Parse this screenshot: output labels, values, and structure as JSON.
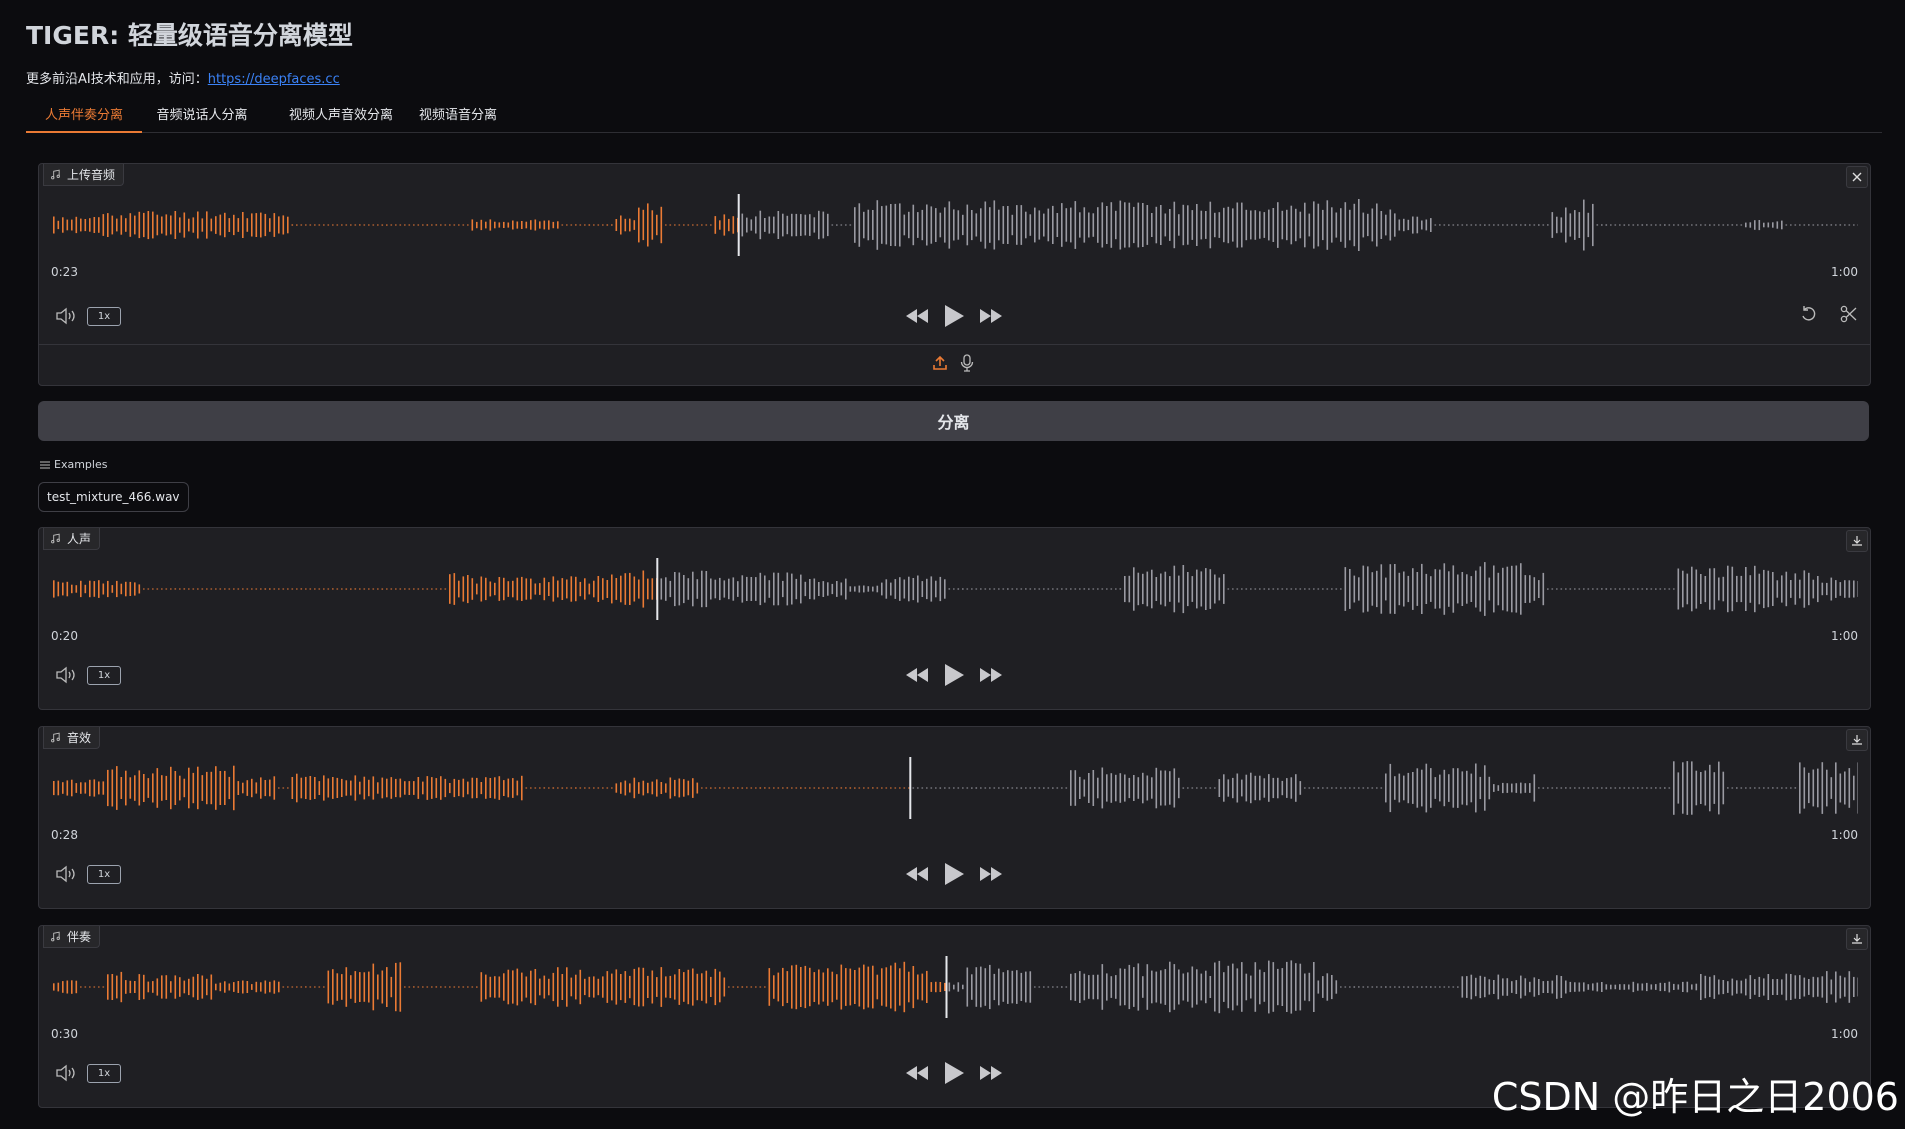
{
  "page": {
    "title": "TIGER: 轻量级语音分离模型",
    "subtitle_text": "更多前沿AI技术和应用，访问：",
    "subtitle_link": "https://deepfaces.cc"
  },
  "tabs": [
    {
      "label": "人声伴奏分离",
      "active": true
    },
    {
      "label": "音频说话人分离",
      "active": false
    },
    {
      "label": "视频人声音效分离",
      "active": false
    },
    {
      "label": "视频语音分离",
      "active": false
    }
  ],
  "upload": {
    "label": "上传音频",
    "current_time": "0:23",
    "duration": "1:00",
    "rate": "1x",
    "progress": 0.38
  },
  "separate_button": "分离",
  "examples": {
    "label": "Examples",
    "items": [
      "test_mixture_466.wav"
    ]
  },
  "outputs": [
    {
      "label": "人声",
      "current_time": "0:20",
      "duration": "1:00",
      "rate": "1x",
      "progress": 0.335
    },
    {
      "label": "音效",
      "current_time": "0:28",
      "duration": "1:00",
      "rate": "1x",
      "progress": 0.475
    },
    {
      "label": "伴奏",
      "current_time": "0:30",
      "duration": "1:00",
      "rate": "1x",
      "progress": 0.495
    }
  ],
  "watermark": "CSDN @昨日之日2006",
  "colors": {
    "accent": "#ea7a34",
    "wave_played": "#ea7a34",
    "wave_unplayed": "#9a9aa2",
    "panel_bg": "#1f1f23",
    "page_bg": "#0c0c0f"
  }
}
